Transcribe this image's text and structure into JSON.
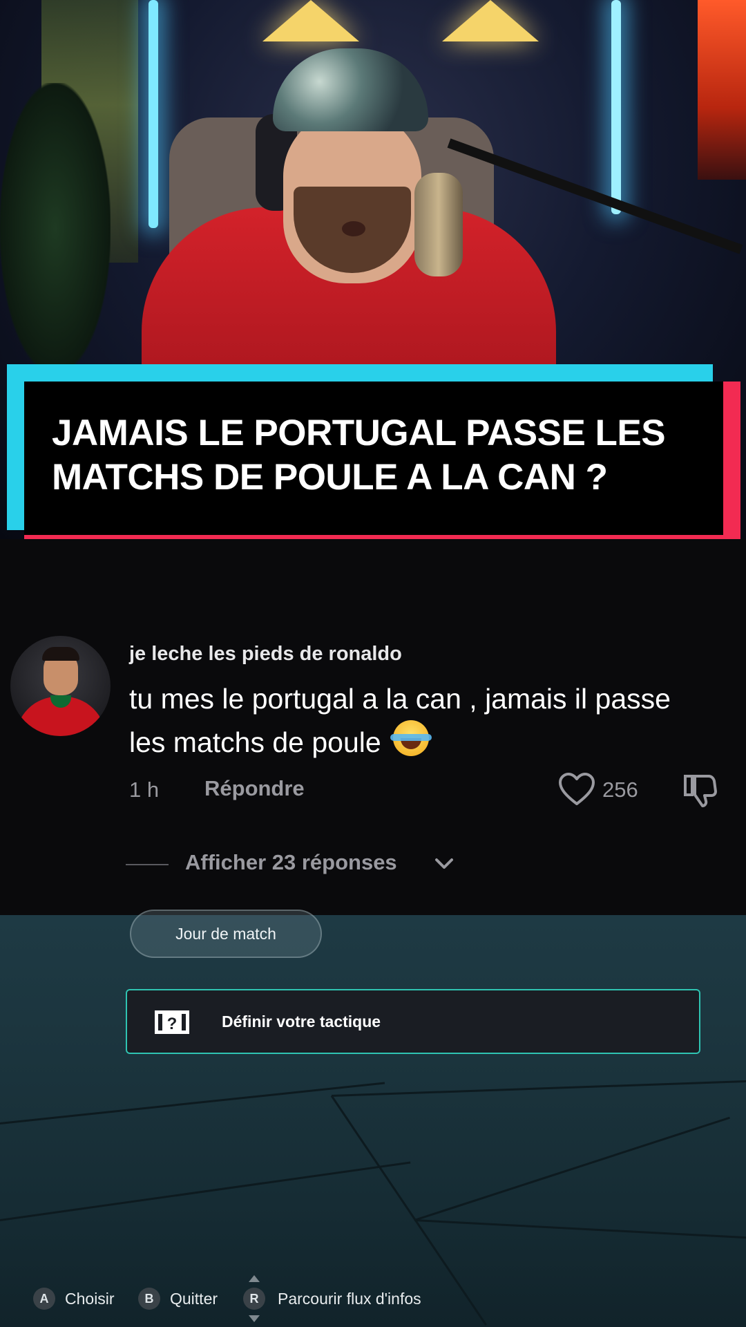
{
  "banner": {
    "title": "JAMAIS LE PORTUGAL PASSE LES MATCHS DE POULE A LA CAN ?"
  },
  "comment": {
    "username": "je leche les pieds de ronaldo",
    "text": "tu mes le portugal a la can , jamais il passe les matchs de poule",
    "emoji_icon": "face-with-tears-of-joy-icon",
    "time": "1 h",
    "reply_label": "Répondre",
    "like_count": "256",
    "view_replies_label": "Afficher 23 réponses"
  },
  "game_menu": {
    "chip_label": "Jour de match",
    "tactic_label": "Définir votre tactique",
    "tactic_icon": "tactics-board-icon",
    "accent_color": "#2fc4b2"
  },
  "controls": [
    {
      "key": "A",
      "label": "Choisir"
    },
    {
      "key": "B",
      "label": "Quitter"
    },
    {
      "key": "R",
      "label": "Parcourir flux d'infos"
    }
  ],
  "colors": {
    "banner_cyan": "#29d0ea",
    "banner_red": "#f22b52",
    "panel_bg": "#0a0a0c",
    "muted_text": "#9a9aa0"
  }
}
